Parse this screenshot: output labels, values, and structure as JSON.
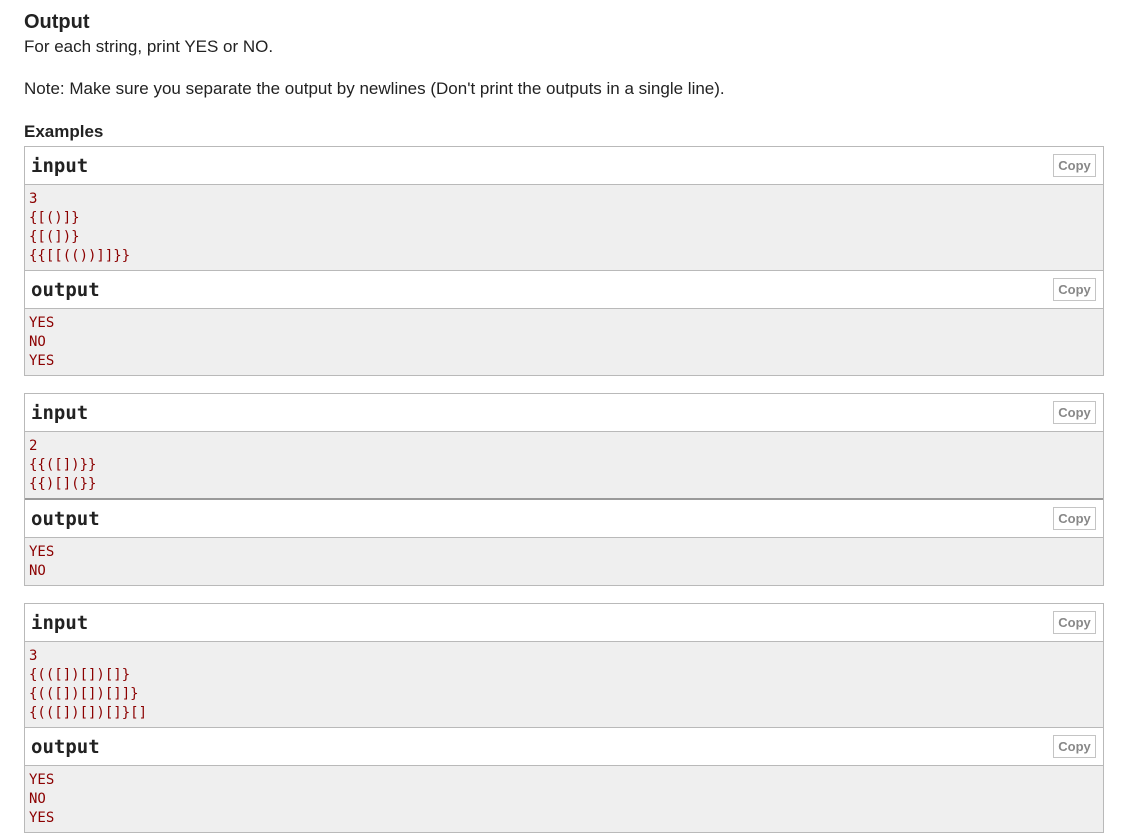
{
  "output_section": {
    "title": "Output",
    "description": "For each string, print YES or NO.",
    "note": "Note: Make sure you separate the output by newlines (Don't print the outputs in a single line)."
  },
  "examples": {
    "title": "Examples",
    "copy_label": "Copy",
    "input_label": "input",
    "output_label": "output",
    "items": [
      {
        "input_lines": [
          "3",
          "{[()]}",
          "{[(])}",
          "{{[[(())]]}}"
        ],
        "output_lines": [
          "YES",
          "NO",
          "YES"
        ]
      },
      {
        "input_lines": [
          "2",
          "{{([])}}",
          "{{)[](}}"
        ],
        "output_lines": [
          "YES",
          "NO"
        ]
      },
      {
        "input_lines": [
          "3",
          "{(([])[])[]}",
          "{(([])[])[]]}",
          "{(([])[])[]}[]"
        ],
        "output_lines": [
          "YES",
          "NO",
          "YES"
        ]
      }
    ]
  }
}
